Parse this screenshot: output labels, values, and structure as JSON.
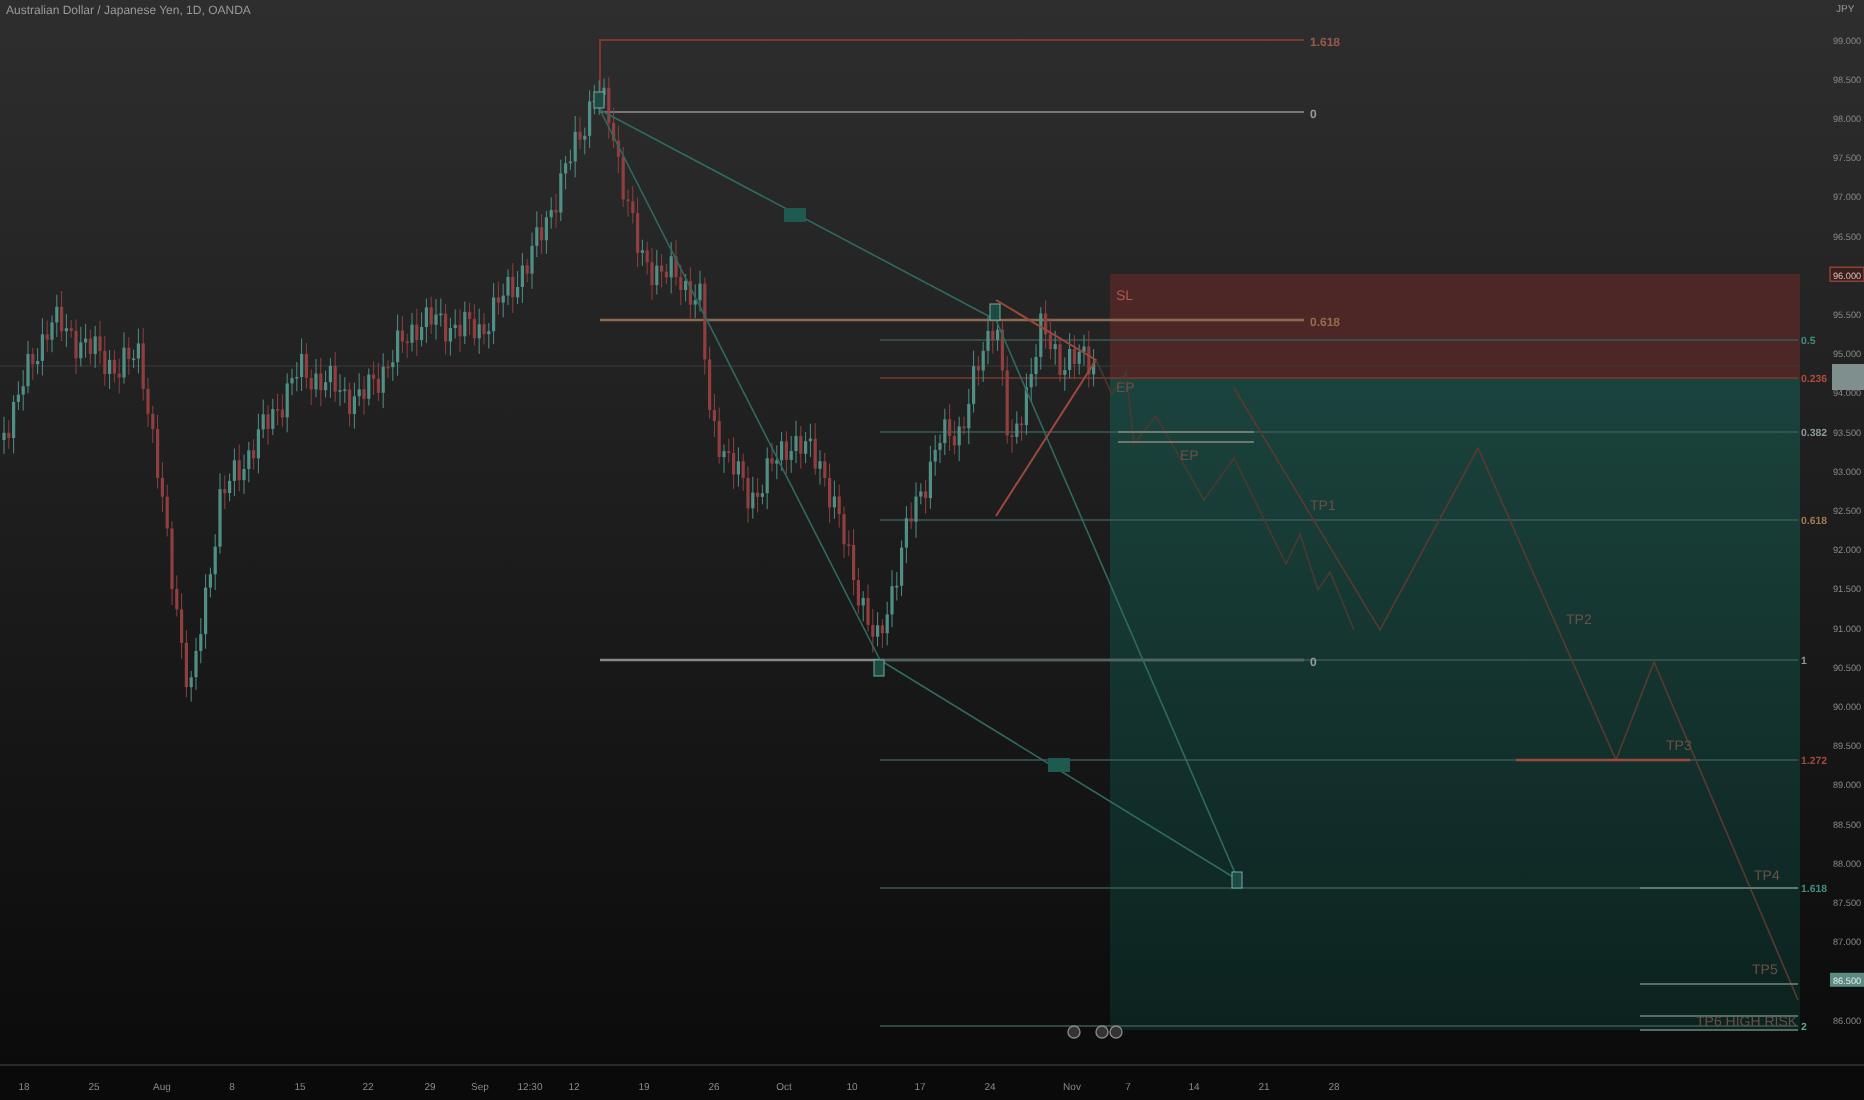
{
  "chart": {
    "title": "Australian Dollar / Japanese Yen, 1D, OANDA",
    "currency": "JPY"
  },
  "price_axis": [
    {
      "label": "99.000",
      "kind": "plain"
    },
    {
      "label": "98.500",
      "kind": "plain"
    },
    {
      "label": "98.000",
      "kind": "plain"
    },
    {
      "label": "97.500",
      "kind": "plain"
    },
    {
      "label": "97.000",
      "kind": "plain"
    },
    {
      "label": "96.500",
      "kind": "plain"
    },
    {
      "label": "96.000",
      "kind": "stop"
    },
    {
      "label": "95.500",
      "kind": "plain"
    },
    {
      "label": "95.000",
      "kind": "plain"
    },
    {
      "label": "94.000",
      "kind": "plain"
    },
    {
      "label": "93.500",
      "kind": "plain"
    },
    {
      "label": "93.000",
      "kind": "plain"
    },
    {
      "label": "92.500",
      "kind": "plain"
    },
    {
      "label": "92.000",
      "kind": "plain"
    },
    {
      "label": "91.500",
      "kind": "plain"
    },
    {
      "label": "91.000",
      "kind": "plain"
    },
    {
      "label": "90.500",
      "kind": "plain"
    },
    {
      "label": "90.000",
      "kind": "plain"
    },
    {
      "label": "89.500",
      "kind": "plain"
    },
    {
      "label": "89.000",
      "kind": "plain"
    },
    {
      "label": "88.500",
      "kind": "plain"
    },
    {
      "label": "88.000",
      "kind": "plain"
    },
    {
      "label": "87.500",
      "kind": "plain"
    },
    {
      "label": "87.000",
      "kind": "plain"
    },
    {
      "label": "86.500",
      "kind": "target"
    },
    {
      "label": "86.000",
      "kind": "plain"
    }
  ],
  "time_axis": [
    "18",
    "25",
    "Aug",
    "8",
    "15",
    "22",
    "29",
    "Sep",
    "12:30",
    "12",
    "19",
    "26",
    "Oct",
    "10",
    "17",
    "24",
    "Nov",
    "7",
    "14",
    "21",
    "28"
  ],
  "fib_left": [
    {
      "label": "1.618",
      "color": "#9a5a4a"
    },
    {
      "label": "0",
      "color": "#9a9a9a"
    },
    {
      "label": "0.618",
      "color": "#9a6a50"
    },
    {
      "label": "0",
      "color": "#9a9a9a"
    }
  ],
  "fib_right": [
    {
      "label": "0.5",
      "color": "#3f8f7f"
    },
    {
      "label": "0.236",
      "color": "#b04a3c"
    },
    {
      "label": "0.382",
      "color": "#8a9a98"
    },
    {
      "label": "0.618",
      "color": "#a07a50"
    },
    {
      "label": "1",
      "color": "#8a9a98"
    },
    {
      "label": "1.272",
      "color": "#a04a3c"
    },
    {
      "label": "1.618",
      "color": "#3f8f7f"
    },
    {
      "label": "2",
      "color": "#5aa090"
    }
  ],
  "trade_labels": [
    {
      "label": "SL"
    },
    {
      "label": "EP"
    },
    {
      "label": "EP"
    },
    {
      "label": "TP1"
    },
    {
      "label": "TP2"
    },
    {
      "label": "TP3"
    },
    {
      "label": "TP4"
    },
    {
      "label": "TP5"
    },
    {
      "label": "TP6 HIGH RISK"
    }
  ]
}
